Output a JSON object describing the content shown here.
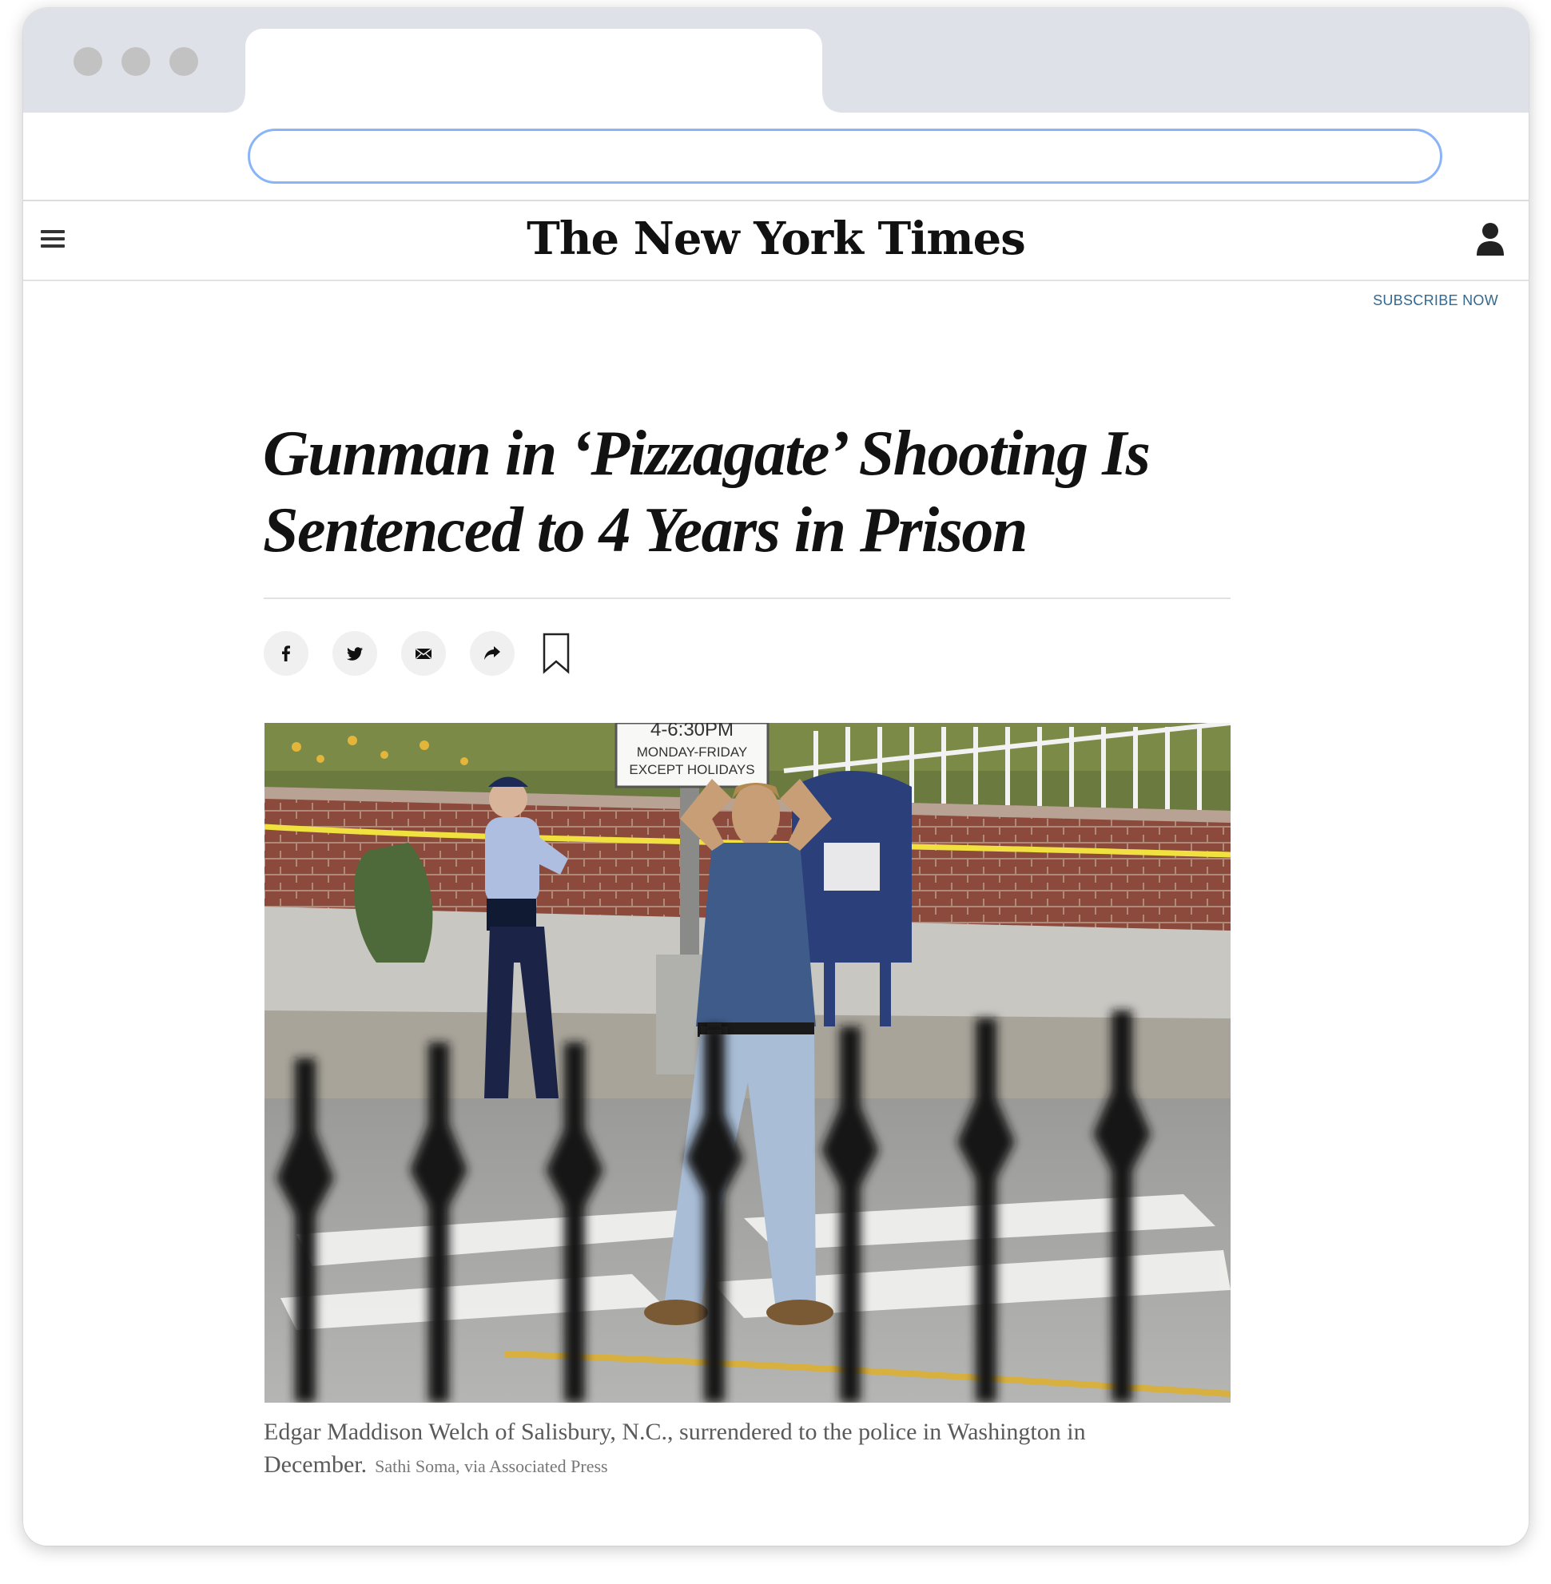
{
  "browser": {
    "tab_title": "",
    "address": ""
  },
  "header": {
    "logo": "The New York Times",
    "subscribe": "SUBSCRIBE NOW"
  },
  "article": {
    "headline": "Gunman in ‘Pizzagate’ Shooting Is Sentenced to 4 Years in Prison",
    "share_buttons": [
      "facebook-icon",
      "twitter-icon",
      "email-icon",
      "share-icon",
      "bookmark-icon"
    ],
    "photo": {
      "sign_line1": "4-6:30PM",
      "sign_line2": "MONDAY-FRIDAY",
      "sign_line3": "EXCEPT HOLIDAYS",
      "caption": "Edgar Maddison Welch of Salisbury, N.C., surrendered to the police in Washington in December.",
      "credit": "Sathi Soma, via Associated Press"
    }
  },
  "colors": {
    "link": "#326891",
    "text": "#121212",
    "chrome": "#dee1e8",
    "url_border": "#8ab4f8"
  }
}
